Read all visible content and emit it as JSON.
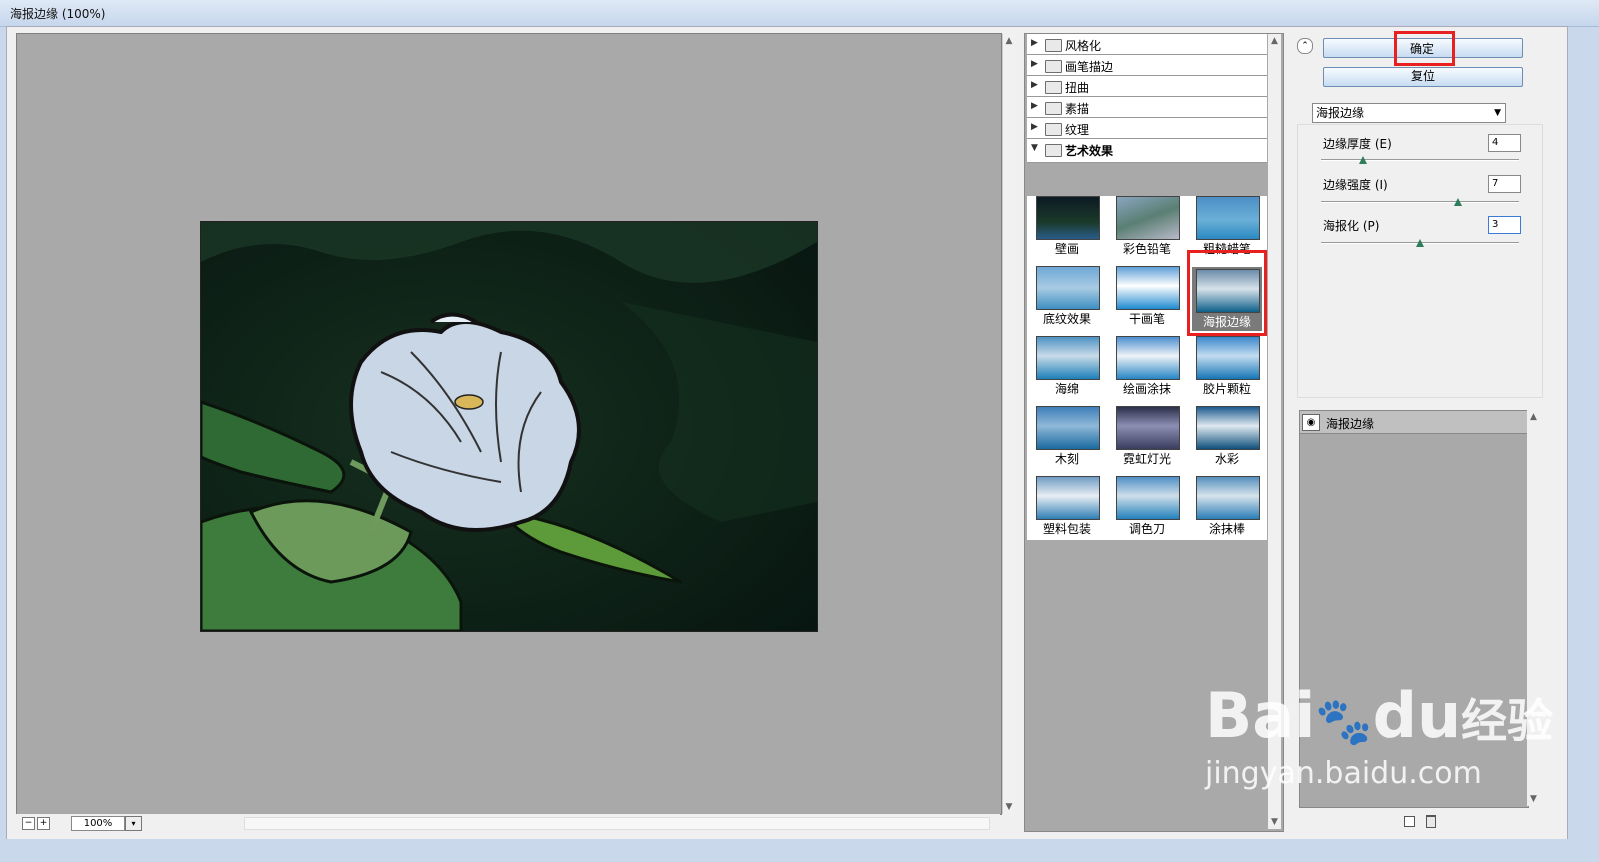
{
  "window": {
    "title": "海报边缘 (100%)"
  },
  "preview": {
    "zoom": "100%",
    "zoom_out": "−",
    "zoom_in": "+",
    "dropdown": "▾"
  },
  "gallery": {
    "groups": [
      {
        "label": "风格化",
        "expanded": false
      },
      {
        "label": "画笔描边",
        "expanded": false
      },
      {
        "label": "扭曲",
        "expanded": false
      },
      {
        "label": "素描",
        "expanded": false
      },
      {
        "label": "纹理",
        "expanded": false
      },
      {
        "label": "艺术效果",
        "expanded": true
      }
    ],
    "filters": [
      "壁画",
      "彩色铅笔",
      "粗糙蜡笔",
      "底纹效果",
      "干画笔",
      "海报边缘",
      "海绵",
      "绘画涂抹",
      "胶片颗粒",
      "木刻",
      "霓虹灯光",
      "水彩",
      "塑料包装",
      "调色刀",
      "涂抹棒"
    ],
    "selected": "海报边缘"
  },
  "buttons": {
    "ok": "确定",
    "reset": "复位"
  },
  "filter_select": {
    "value": "海报边缘"
  },
  "params": [
    {
      "label": "边缘厚度 (E)",
      "value": "4",
      "level": 0.2
    },
    {
      "label": "边缘强度 (I)",
      "value": "7",
      "level": 0.7
    },
    {
      "label": "海报化 (P)",
      "value": "3",
      "level": 0.5
    }
  ],
  "layers": {
    "effect": "海报边缘"
  },
  "watermark": {
    "brand": "Bai",
    "brand2": "du",
    "cn": "经验",
    "url": "jingyan.baidu.com"
  },
  "colors": {
    "highlight": "#e8201f",
    "preview_bg": "#a9a9a9"
  }
}
